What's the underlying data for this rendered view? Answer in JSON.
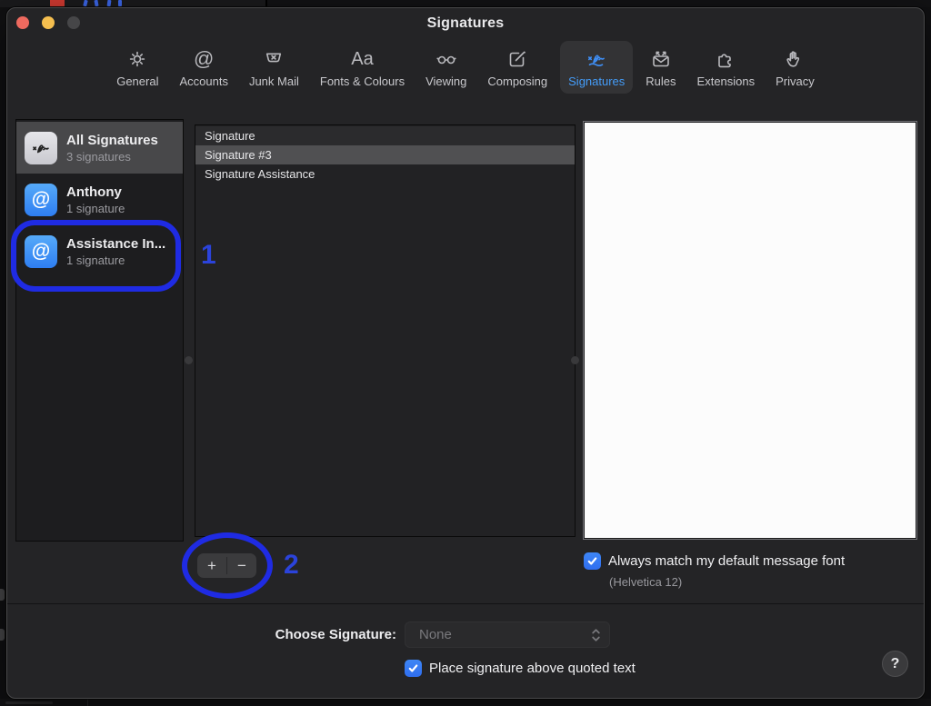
{
  "window": {
    "title": "Signatures"
  },
  "toolbar": {
    "items": [
      {
        "label": "General",
        "icon": "gear-icon",
        "selected": false
      },
      {
        "label": "Accounts",
        "icon": "at-icon",
        "selected": false
      },
      {
        "label": "Junk Mail",
        "icon": "junk-bin-icon",
        "selected": false
      },
      {
        "label": "Fonts & Colours",
        "icon": "fonts-icon",
        "selected": false
      },
      {
        "label": "Viewing",
        "icon": "glasses-icon",
        "selected": false
      },
      {
        "label": "Composing",
        "icon": "compose-icon",
        "selected": false
      },
      {
        "label": "Signatures",
        "icon": "signature-icon",
        "selected": true
      },
      {
        "label": "Rules",
        "icon": "rules-envelope-icon",
        "selected": false
      },
      {
        "label": "Extensions",
        "icon": "puzzle-icon",
        "selected": false
      },
      {
        "label": "Privacy",
        "icon": "hand-icon",
        "selected": false
      }
    ]
  },
  "sidebar": {
    "items": [
      {
        "name": "All Signatures",
        "count": "3 signatures",
        "icon": "signature-avatar-icon",
        "selected": true,
        "annotated": false
      },
      {
        "name": "Anthony",
        "count": "1 signature",
        "icon": "at-avatar-icon",
        "selected": false,
        "annotated": false
      },
      {
        "name": "Assistance In...",
        "count": "1 signature",
        "icon": "at-avatar-icon",
        "selected": false,
        "annotated": true
      }
    ]
  },
  "signature_list": {
    "items": [
      {
        "name": "Signature",
        "selected": false
      },
      {
        "name": "Signature #3",
        "selected": true
      },
      {
        "name": "Signature Assistance",
        "selected": false
      }
    ],
    "add_label": "+",
    "remove_label": "−"
  },
  "options": {
    "match_font_label": "Always match my default message font",
    "match_font_sub": "(Helvetica 12)",
    "match_font_checked": true,
    "choose_signature_label": "Choose Signature:",
    "choose_signature_value": "None",
    "place_above_label": "Place signature above quoted text",
    "place_above_checked": true
  },
  "annotations": {
    "step1": "1",
    "step2": "2",
    "color": "#1f2be3"
  },
  "help_label": "?",
  "colors": {
    "accent_blue": "#449CF8",
    "checkbox_blue": "#3578F2",
    "annotation_blue": "#1f2be3",
    "selection_gray": "#505052"
  }
}
